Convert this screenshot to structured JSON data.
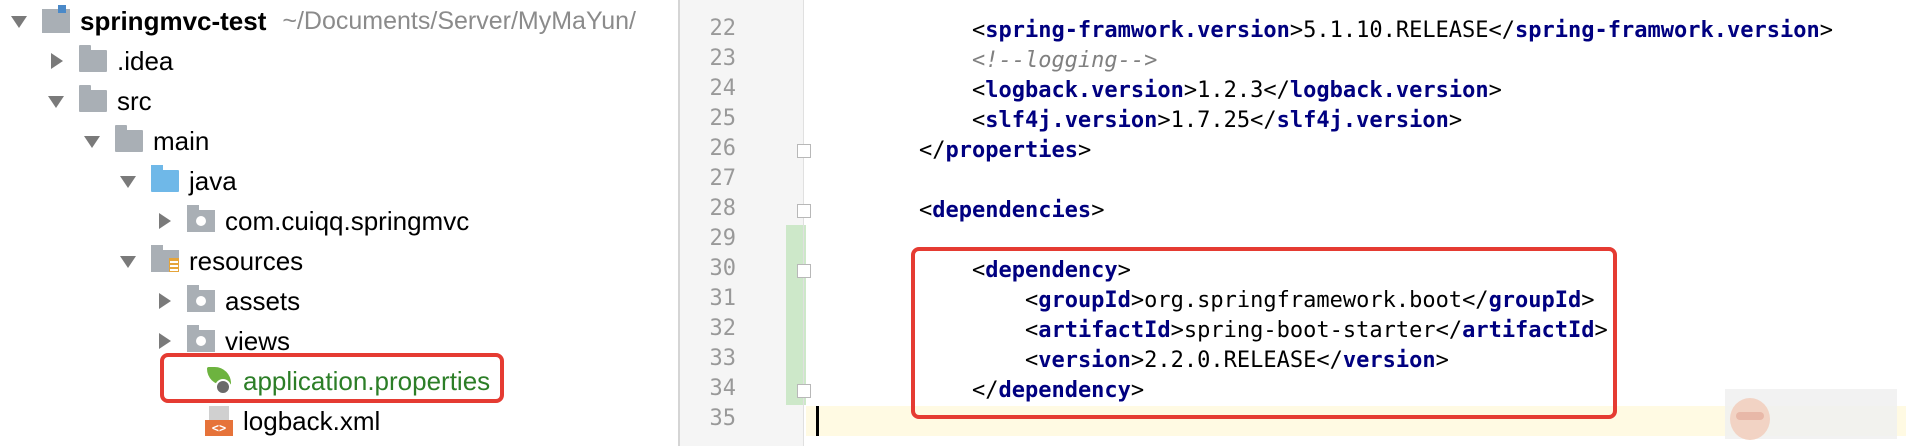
{
  "project": {
    "name": "springmvc-test",
    "path": "~/Documents/Server/MyMaYun/"
  },
  "tree": [
    {
      "label": ".idea",
      "icon": "folder-icon",
      "state": "collapsed"
    },
    {
      "label": "src",
      "icon": "folder-icon",
      "state": "expanded"
    },
    {
      "label": "main",
      "icon": "folder-icon",
      "state": "expanded"
    },
    {
      "label": "java",
      "icon": "source-folder-icon",
      "state": "expanded"
    },
    {
      "label": "com.cuiqq.springmvc",
      "icon": "package-icon",
      "state": "collapsed"
    },
    {
      "label": "resources",
      "icon": "resources-folder-icon",
      "state": "expanded"
    },
    {
      "label": "assets",
      "icon": "package-icon",
      "state": "collapsed"
    },
    {
      "label": "views",
      "icon": "package-icon",
      "state": "collapsed"
    },
    {
      "label": "application.properties",
      "icon": "spring-boot-icon",
      "state": "file"
    },
    {
      "label": "logback.xml",
      "icon": "xml-file-icon",
      "state": "file"
    }
  ],
  "editor": {
    "lines": [
      {
        "n": "22",
        "indent": "        ",
        "open": "spring-framwork.version",
        "text": "5.1.10.RELEASE",
        "close": "spring-framwork.version"
      },
      {
        "n": "23",
        "indent": "        ",
        "comment": "<!--logging-->"
      },
      {
        "n": "24",
        "indent": "        ",
        "open": "logback.version",
        "text": "1.2.3",
        "close": "logback.version"
      },
      {
        "n": "25",
        "indent": "        ",
        "open": "slf4j.version",
        "text": "1.7.25",
        "close": "slf4j.version"
      },
      {
        "n": "26",
        "indent": "    ",
        "close_only": "properties"
      },
      {
        "n": "27"
      },
      {
        "n": "28",
        "indent": "    ",
        "open_only": "dependencies"
      },
      {
        "n": "29"
      },
      {
        "n": "30",
        "indent": "        ",
        "open_only": "dependency"
      },
      {
        "n": "31",
        "indent": "            ",
        "open": "groupId",
        "text": "org.springframework.boot",
        "close": "groupId"
      },
      {
        "n": "32",
        "indent": "            ",
        "open": "artifactId",
        "text": "spring-boot-starter",
        "close": "artifactId"
      },
      {
        "n": "33",
        "indent": "            ",
        "open": "version",
        "text": "2.2.0.RELEASE",
        "close": "version"
      },
      {
        "n": "34",
        "indent": "        ",
        "close_only": "dependency"
      },
      {
        "n": "35"
      }
    ]
  }
}
